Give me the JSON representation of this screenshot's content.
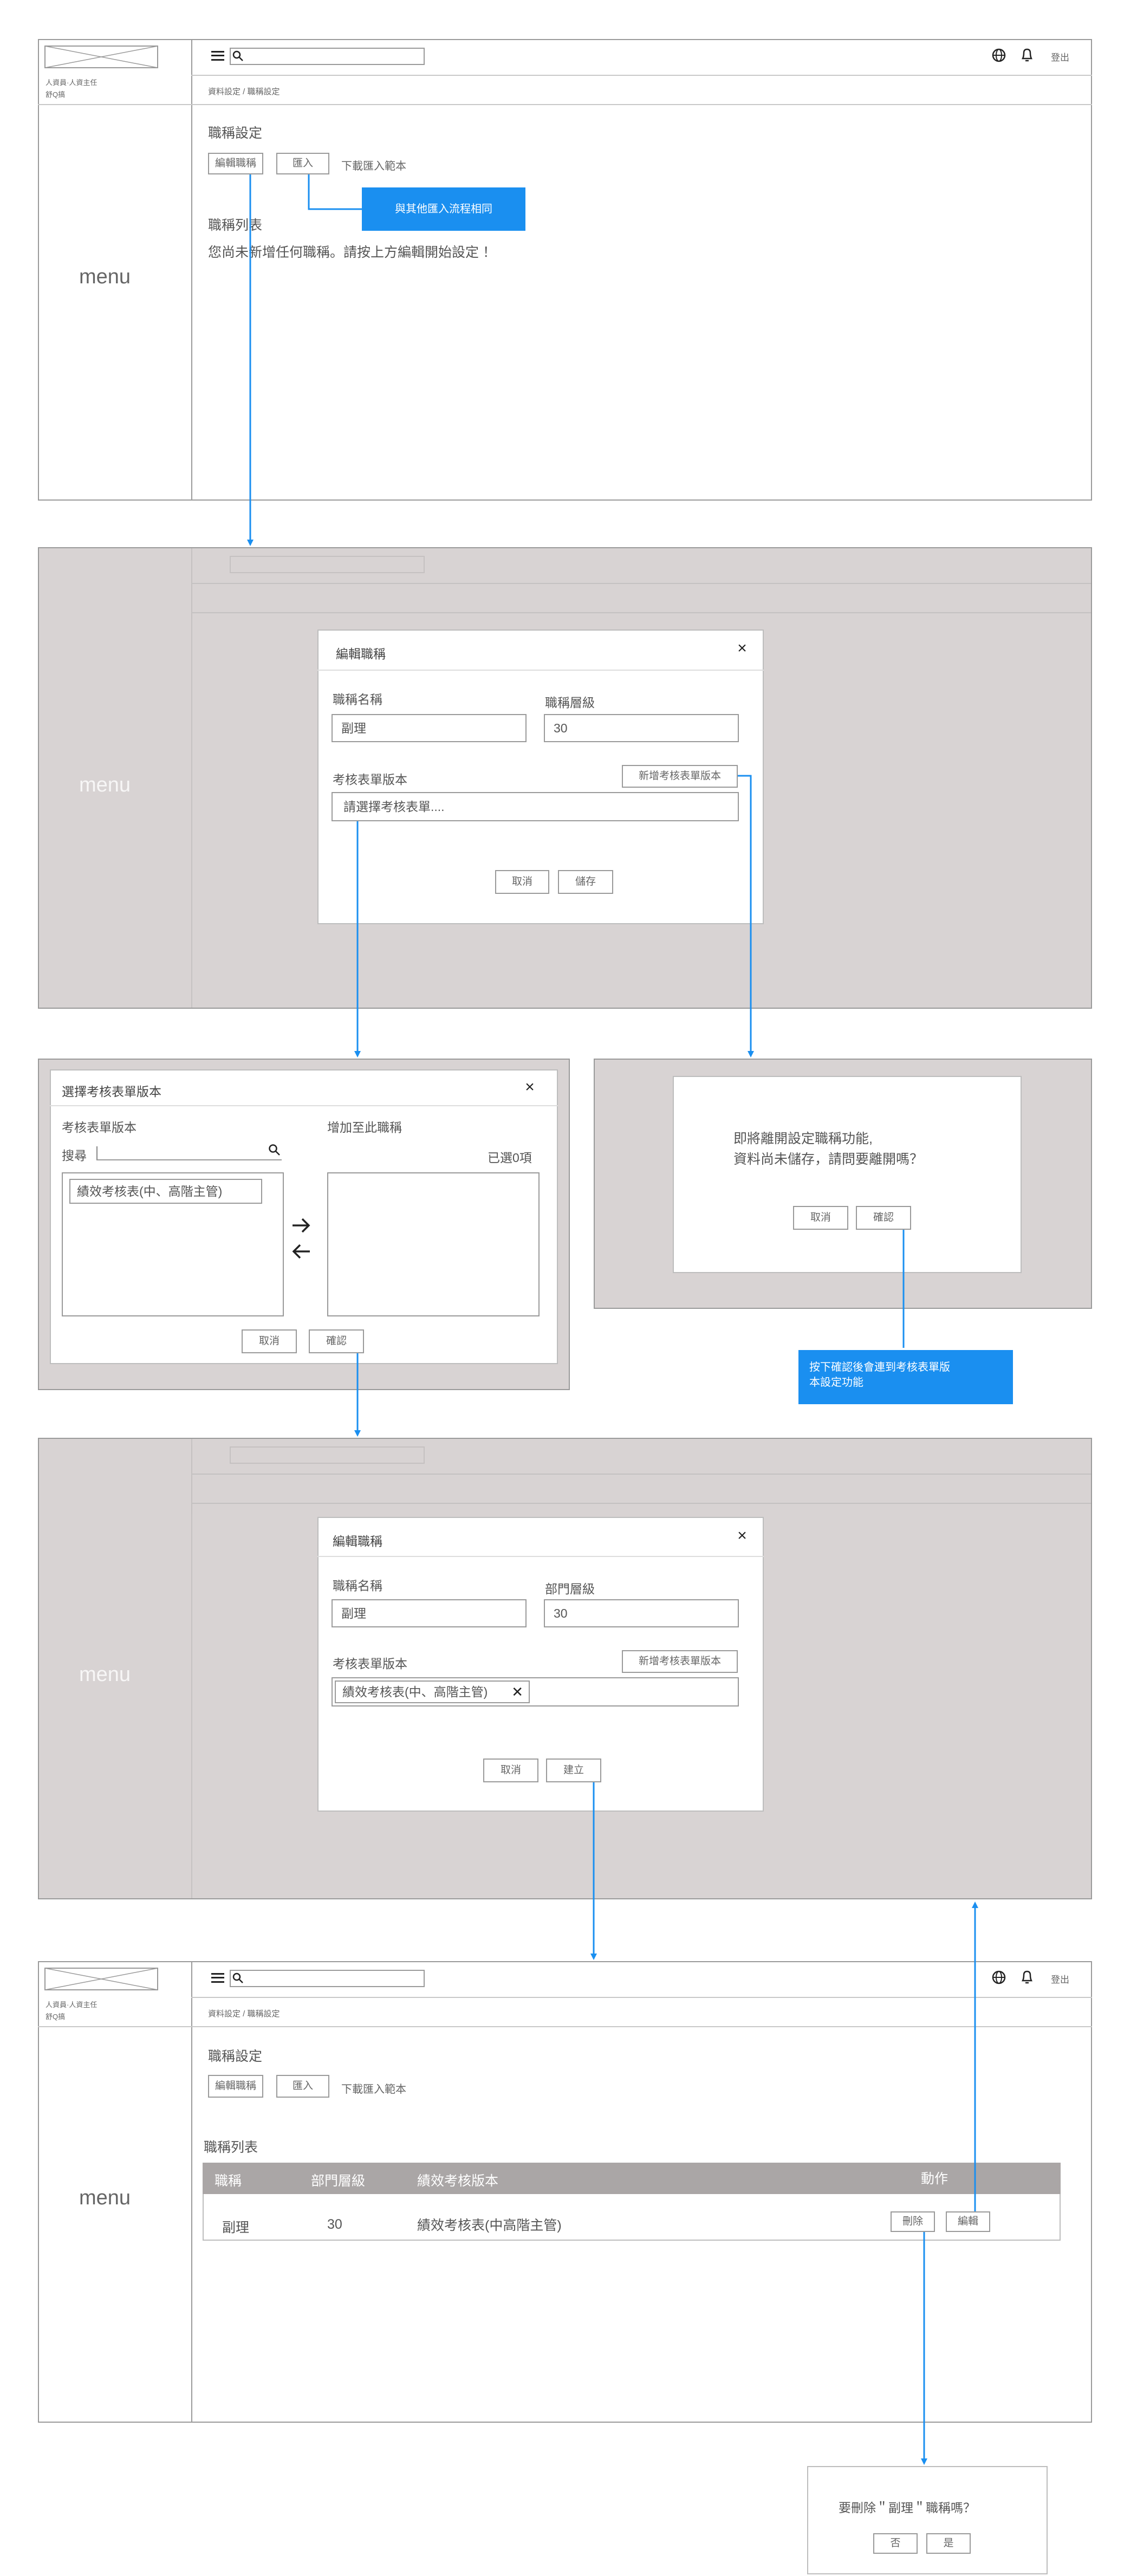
{
  "header": {
    "user_line1": "人資員·人資主任",
    "user_line2": "舒Q搞",
    "logout": "登出",
    "breadcrumb": "資料設定 / 職稱設定",
    "menu": "menu"
  },
  "screen1": {
    "section_title": "職稱設定",
    "btn_edit": "編輯職稱",
    "btn_import": "匯入",
    "link_download": "下載匯入範本",
    "note_import": "與其他匯入流程相同",
    "list_title": "職稱列表",
    "empty_text": "您尚未新增任何職稱。請按上方編輯開始設定 ！"
  },
  "screen2": {
    "modal_title": "編輯職稱",
    "label_name": "職稱名稱",
    "value_name": "副理",
    "label_level": "職稱層級",
    "value_level": "30",
    "label_form": "考核表單版本",
    "btn_new_form": "新增考核表單版本",
    "placeholder_form": "請選擇考核表單....",
    "btn_cancel": "取消",
    "btn_save": "儲存"
  },
  "screen3": {
    "modal_title": "選擇考核表單版本",
    "left_title": "考核表單版本",
    "search_label": "搜尋",
    "right_title": "增加至此職稱",
    "selected_count": "已選0項",
    "item": "績效考核表(中、高階主管)",
    "btn_cancel": "取消",
    "btn_confirm": "確認"
  },
  "screen4": {
    "msg_line1": "即將離開設定職稱功能,",
    "msg_line2": "資料尚未儲存，請問要離開嗎？",
    "btn_cancel": "取消",
    "btn_confirm": "確認",
    "note": "按下確認後會連到考核表單版本設定功能"
  },
  "screen5": {
    "modal_title": "編輯職稱",
    "label_name": "職稱名稱",
    "value_name": "副理",
    "label_level": "部門層級",
    "value_level": "30",
    "label_form": "考核表單版本",
    "btn_new_form": "新增考核表單版本",
    "tag": "績效考核表(中、高階主管)",
    "btn_cancel": "取消",
    "btn_create": "建立"
  },
  "screen6": {
    "section_title": "職稱設定",
    "btn_edit": "編輯職稱",
    "btn_import": "匯入",
    "link_download": "下載匯入範本",
    "list_title": "職稱列表",
    "columns": [
      "職稱",
      "部門層級",
      "績效考核版本",
      "動作"
    ],
    "rows": [
      {
        "title": "副理",
        "level": "30",
        "form": "績效考核表(中高階主管)"
      }
    ],
    "btn_delete": "刪除",
    "btn_edit_row": "編輯"
  },
  "dialog_delete": {
    "msg": "要刪除＂副理＂職稱嗎？",
    "btn_no": "否",
    "btn_yes": "是"
  },
  "colors": {
    "accent": "#1a8ff0",
    "overlay": "#d8d3d3",
    "table_header": "#aaa6a6"
  }
}
